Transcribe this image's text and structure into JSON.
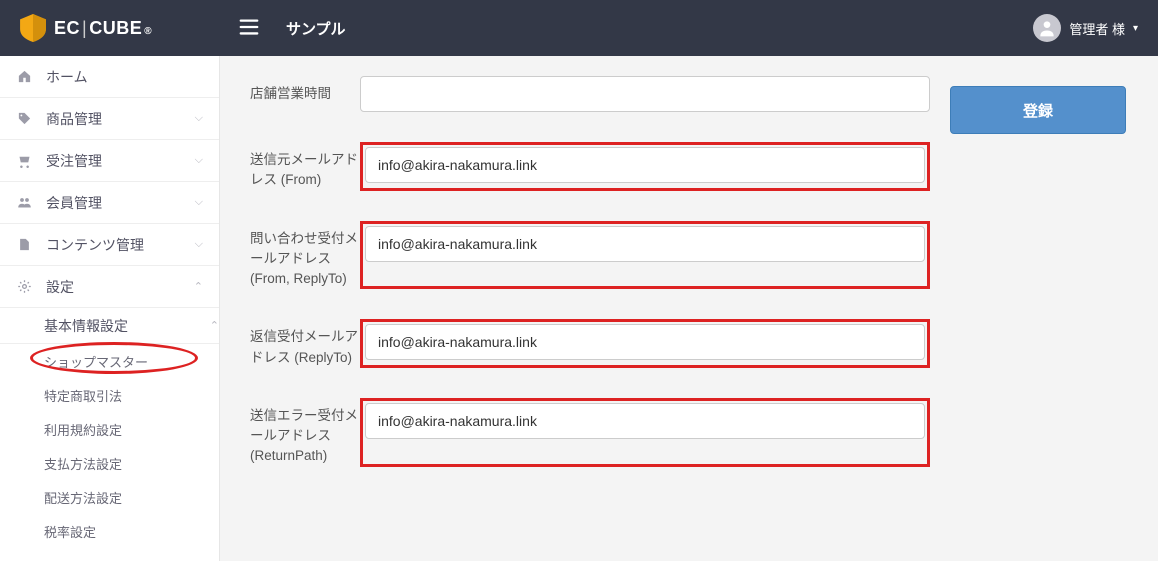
{
  "header": {
    "logo_text_ec": "EC",
    "logo_text_cube": "CUBE",
    "site_title": "サンプル",
    "user_name": "管理者 様"
  },
  "sidebar": {
    "items": [
      {
        "icon": "home",
        "label": "ホーム",
        "chevron": ""
      },
      {
        "icon": "tag",
        "label": "商品管理",
        "chevron": "down"
      },
      {
        "icon": "cart",
        "label": "受注管理",
        "chevron": "down"
      },
      {
        "icon": "users",
        "label": "会員管理",
        "chevron": "down"
      },
      {
        "icon": "file",
        "label": "コンテンツ管理",
        "chevron": "down"
      },
      {
        "icon": "gear",
        "label": "設定",
        "chevron": "up"
      }
    ],
    "sub1": {
      "label": "基本情報設定",
      "chevron": "up"
    },
    "sub2": [
      {
        "label": "ショップマスター",
        "highlighted": true
      },
      {
        "label": "特定商取引法"
      },
      {
        "label": "利用規約設定"
      },
      {
        "label": "支払方法設定"
      },
      {
        "label": "配送方法設定"
      },
      {
        "label": "税率設定"
      }
    ]
  },
  "form": {
    "rows": [
      {
        "label": "店舗営業時間",
        "value": "",
        "highlighted": false
      },
      {
        "label": "送信元メールアドレス (From)",
        "value": "info@akira-nakamura.link",
        "highlighted": true
      },
      {
        "label": "問い合わせ受付メールアドレス (From, ReplyTo)",
        "value": "info@akira-nakamura.link",
        "highlighted": true
      },
      {
        "label": "返信受付メールアドレス (ReplyTo)",
        "value": "info@akira-nakamura.link",
        "highlighted": true
      },
      {
        "label": "送信エラー受付メールアドレス (ReturnPath)",
        "value": "info@akira-nakamura.link",
        "highlighted": true
      }
    ]
  },
  "actions": {
    "save": "登録"
  }
}
